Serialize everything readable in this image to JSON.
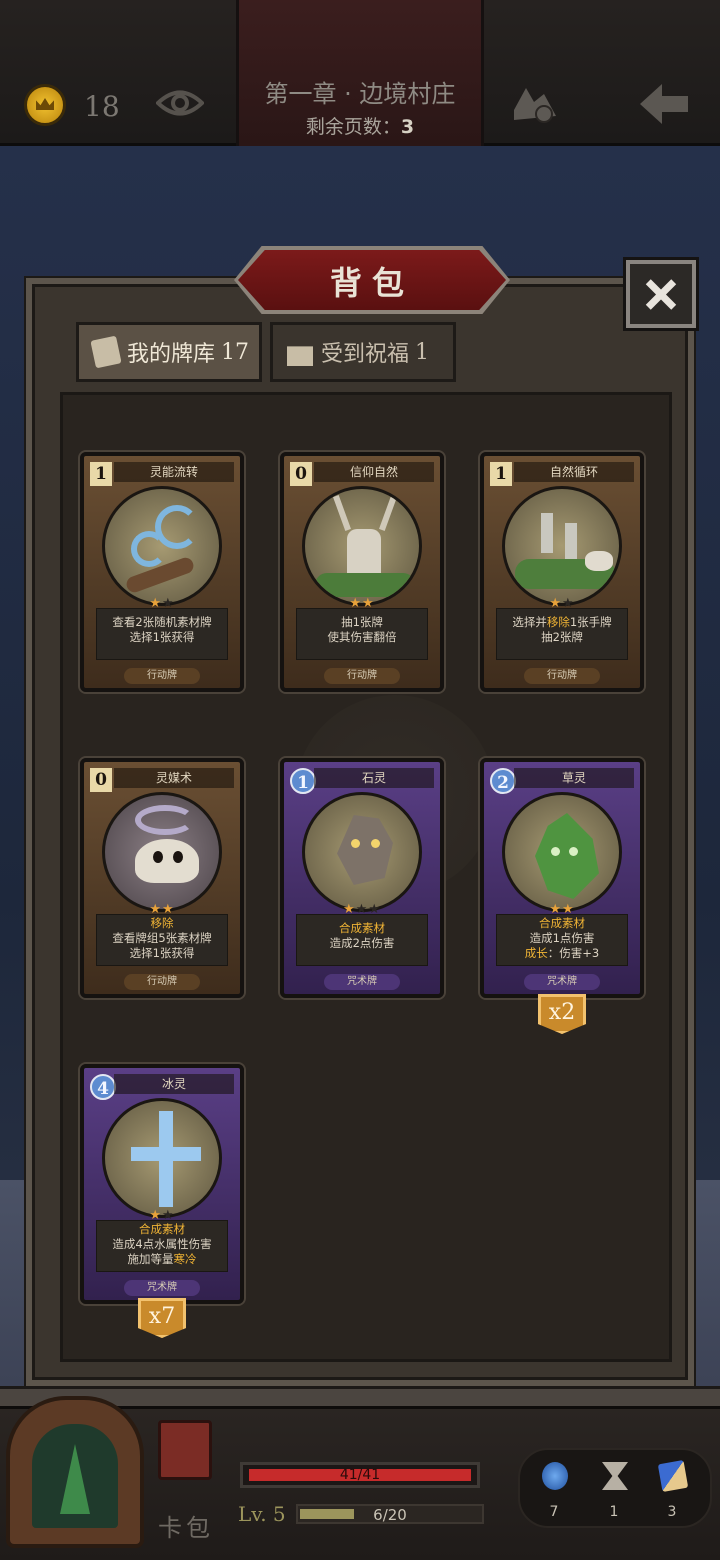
{
  "topbar": {
    "coin_count": "18",
    "chapter_title": "第一章 · 边境村庄",
    "pages_label": "剩余页数：",
    "pages_value": "3"
  },
  "panel": {
    "title": "背包",
    "tabs": [
      {
        "label": "我的牌库",
        "count": "17"
      },
      {
        "label": "受到祝福",
        "count": "1"
      }
    ]
  },
  "cards": [
    {
      "cost": "1",
      "name": "灵能流转",
      "kind": "action",
      "stars": 1,
      "max_stars": 2,
      "desc_line1": "查看2张随机素材牌",
      "desc_line2": "选择1张获得",
      "type": "行动牌"
    },
    {
      "cost": "0",
      "name": "信仰自然",
      "kind": "action",
      "stars": 2,
      "max_stars": 2,
      "desc_line1": "抽1张牌",
      "desc_line2": "使其伤害翻倍",
      "type": "行动牌"
    },
    {
      "cost": "1",
      "name": "自然循环",
      "kind": "action",
      "stars": 1,
      "max_stars": 2,
      "desc_line1_a": "选择并",
      "desc_line1_hl": "移除",
      "desc_line1_b": "1张手牌",
      "desc_line2": "抽2张牌",
      "type": "行动牌"
    },
    {
      "cost": "0",
      "name": "灵媒术",
      "kind": "action",
      "stars": 2,
      "max_stars": 2,
      "desc_hl": "移除",
      "desc_line1": "查看牌组5张素材牌",
      "desc_line2": "选择1张获得",
      "type": "行动牌"
    },
    {
      "cost": "1",
      "name": "石灵",
      "kind": "spell",
      "stars": 1,
      "max_stars": 3,
      "desc_hl": "合成素材",
      "desc_line1": "造成2点伤害",
      "type": "咒术牌"
    },
    {
      "cost": "2",
      "name": "草灵",
      "kind": "spell",
      "stars": 2,
      "max_stars": 2,
      "desc_hl": "合成素材",
      "desc_line1": "造成1点伤害",
      "desc_line2_hl": "成长",
      "desc_line2_b": "：伤害+3",
      "type": "咒术牌",
      "multiplier": "x2"
    },
    {
      "cost": "4",
      "name": "冰灵",
      "kind": "spell",
      "stars": 1,
      "max_stars": 2,
      "desc_hl": "合成素材",
      "desc_line1": "造成4点水属性伤害",
      "desc_line2_a": "施加等量",
      "desc_line2_hl": "寒冷",
      "type": "咒术牌",
      "multiplier": "x7"
    }
  ],
  "bottombar": {
    "pack_label": "卡包",
    "hp_text": "41/41",
    "hp": 41,
    "hp_max": 41,
    "level": "Lv. 5",
    "xp_text": "6/20",
    "xp": 6,
    "xp_max": 20,
    "resources": [
      {
        "icon": "potion-icon",
        "count": "7"
      },
      {
        "icon": "hourglass-icon",
        "count": "1"
      },
      {
        "icon": "cards-icon",
        "count": "3"
      }
    ]
  },
  "colors": {
    "accent_gold": "#f0b435",
    "hp_red": "#c62b2b",
    "spell_purple": "#5a3f86",
    "action_brown": "#6a4f33"
  }
}
